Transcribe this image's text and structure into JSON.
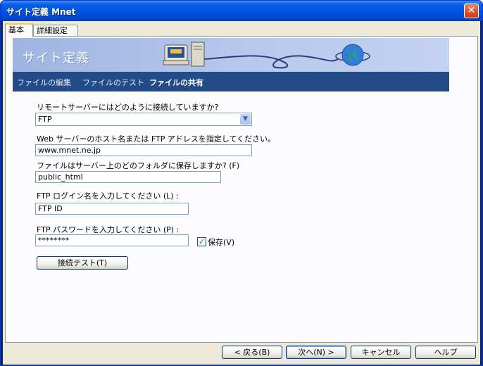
{
  "window": {
    "title": "サイト定義 Mnet",
    "close_glyph": "✕"
  },
  "tabs": [
    {
      "label": "基本"
    },
    {
      "label": "詳細設定"
    }
  ],
  "banner": {
    "title": "サイト定義"
  },
  "steps": [
    {
      "label": "ファイルの編集"
    },
    {
      "label": "ファイルのテスト"
    },
    {
      "label": "ファイルの共有"
    }
  ],
  "form": {
    "connection_label": "リモートサーバーにはどのように接続していますか?",
    "connection_value": "FTP",
    "host_label": "Web サーバーのホスト名または FTP アドレスを指定してください。",
    "host_value": "www.mnet.ne.jp",
    "folder_label": "ファイルはサーバー上のどのフォルダに保存しますか? (F)",
    "folder_value": "public_html",
    "login_label": "FTP ログイン名を入力してください (L) :",
    "login_value": "FTP ID",
    "password_label": "FTP パスワードを入力してください (P) :",
    "password_value": "********",
    "save_label": "保存(V)",
    "save_checked": true,
    "test_button": "接続テスト(T)"
  },
  "footer": {
    "back": "< 戻る(B)",
    "next": "次へ(N) >",
    "cancel": "キャンセル",
    "help": "ヘルプ"
  }
}
